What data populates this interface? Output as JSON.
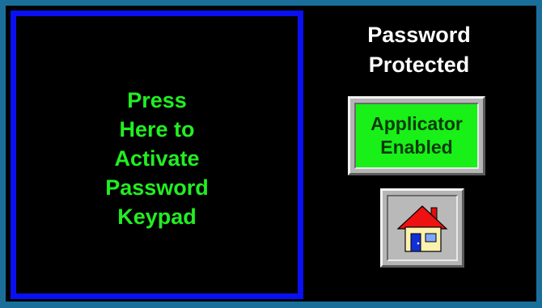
{
  "keypad_activator": {
    "label": "Press\nHere to\nActivate\nPassword\nKeypad"
  },
  "status": {
    "title": "Password\nProtected"
  },
  "applicator_button": {
    "label": "Applicator\nEnabled",
    "color": "#18f018"
  },
  "home_button": {
    "icon": "home-icon"
  },
  "colors": {
    "frame": "#1a6f9a",
    "background": "#000000",
    "keypad_border": "#0a10f0",
    "keypad_text": "#22ee22",
    "title_text": "#ffffff"
  }
}
